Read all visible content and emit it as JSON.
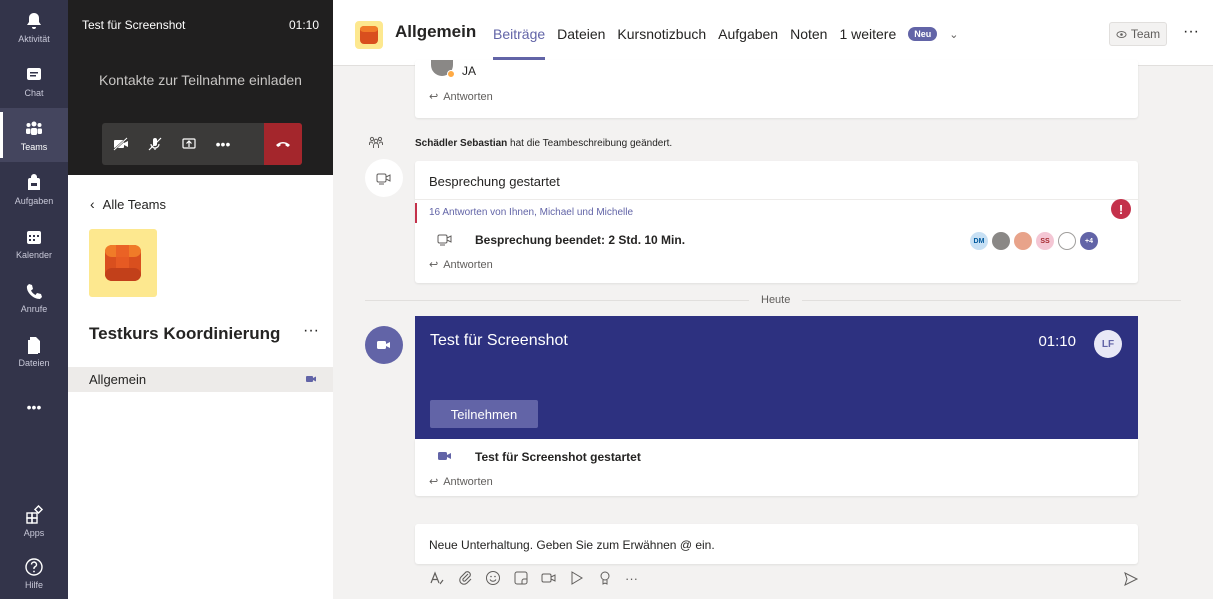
{
  "rail": {
    "items": [
      {
        "label": "Aktivität",
        "icon": "bell-icon"
      },
      {
        "label": "Chat",
        "icon": "chat-icon"
      },
      {
        "label": "Teams",
        "icon": "teams-icon"
      },
      {
        "label": "Aufgaben",
        "icon": "backpack-icon"
      },
      {
        "label": "Kalender",
        "icon": "calendar-icon"
      },
      {
        "label": "Anrufe",
        "icon": "phone-icon"
      },
      {
        "label": "Dateien",
        "icon": "file-icon"
      },
      {
        "label": "Apps",
        "icon": "apps-icon"
      },
      {
        "label": "Hilfe",
        "icon": "help-icon"
      }
    ],
    "more": "•••"
  },
  "call": {
    "title": "Test für Screenshot",
    "time": "01:10",
    "invite": "Kontakte zur Teilnahme einladen"
  },
  "left": {
    "back": "Alle Teams",
    "team_name": "Testkurs Koordinierung",
    "more": "···",
    "channel": "Allgemein"
  },
  "header": {
    "title": "Allgemein",
    "tabs": [
      "Beiträge",
      "Dateien",
      "Kursnotizbuch",
      "Aufgaben",
      "Noten",
      "1 weitere"
    ],
    "badge": "Neu",
    "team_button": "Team",
    "more": "···"
  },
  "feed": {
    "top_card": {
      "author_initials": "JA",
      "reply": "Antworten"
    },
    "system_msg": {
      "author": "Schädler Sebastian",
      "text": "hat die Teambeschreibung geändert."
    },
    "meeting_card": {
      "title": "Besprechung gestartet",
      "replies_link": "16 Antworten von Ihnen, Michael und Michelle",
      "ended": "Besprechung beendet: 2 Std. 10 Min.",
      "participants": [
        "DM",
        "SS",
        "+4"
      ],
      "reply": "Antworten"
    },
    "day_divider": "Heute",
    "live_meeting": {
      "title": "Test für Screenshot",
      "time": "01:10",
      "initials": "LF",
      "join": "Teilnehmen",
      "started": "Test für Screenshot gestartet",
      "reply": "Antworten"
    },
    "compose_placeholder": "Neue Unterhaltung. Geben Sie zum Erwähnen @ ein."
  },
  "colors": {
    "rail": "#33344a",
    "accent": "#6264a7",
    "live_meeting": "#2d3180",
    "hangup": "#a4262c",
    "urgent": "#c4314b"
  }
}
